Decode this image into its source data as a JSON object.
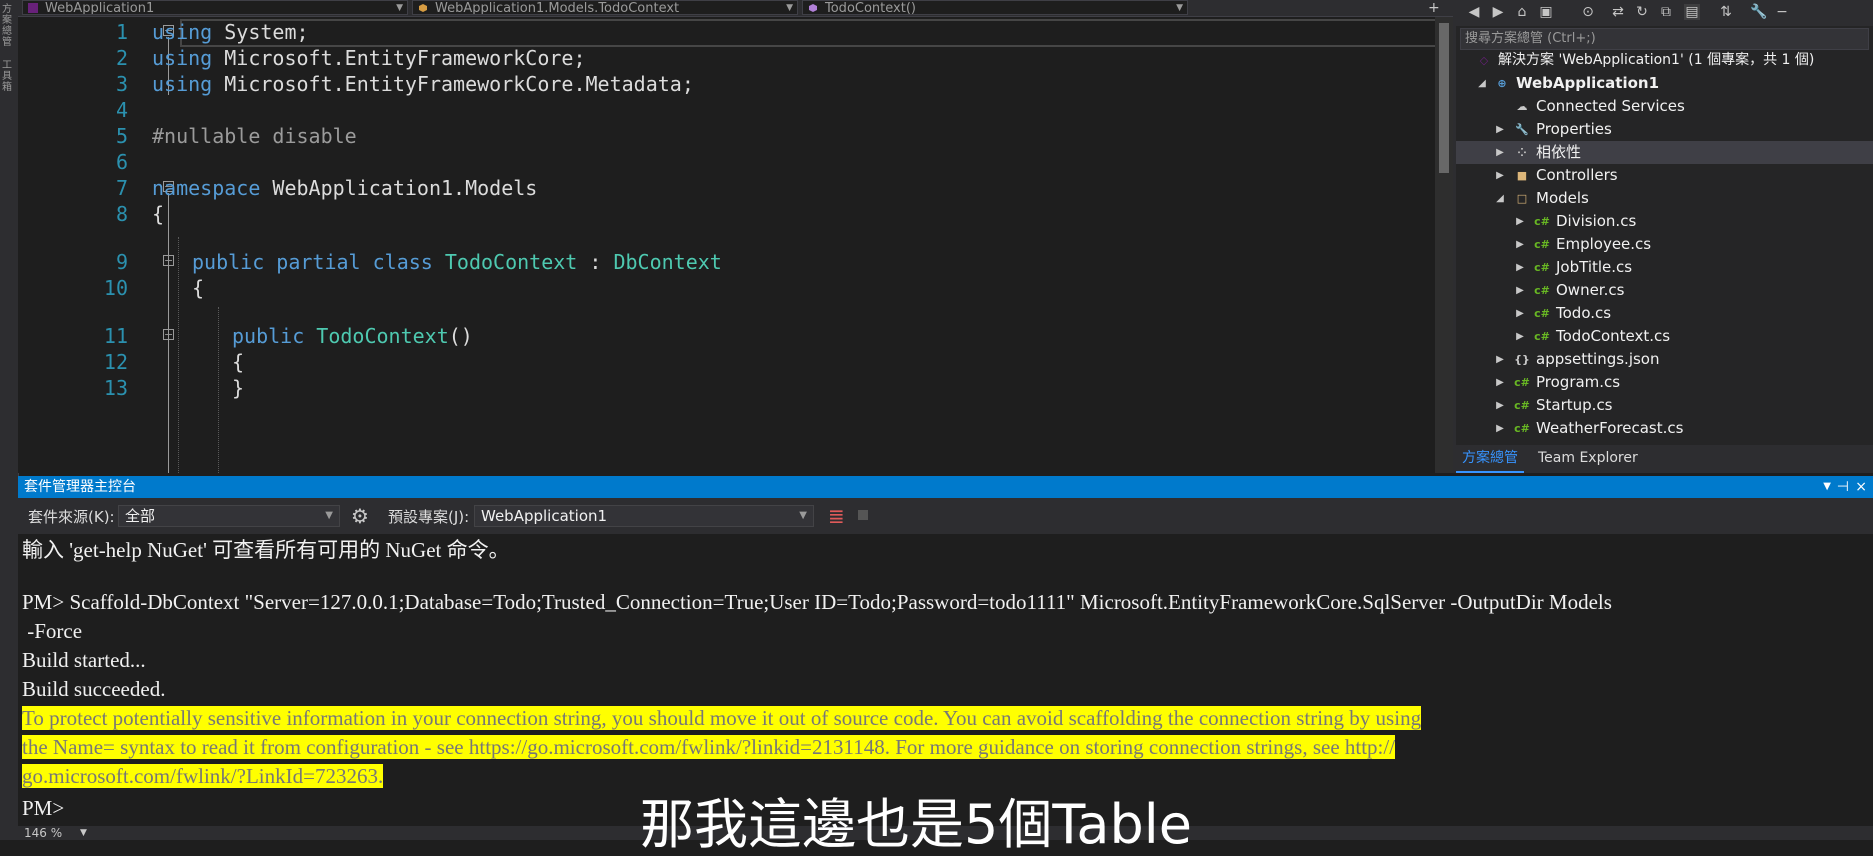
{
  "left_strip": {
    "tab1": "方案總管",
    "tab2": "工具箱"
  },
  "nav": {
    "project": "WebApplication1",
    "class": "WebApplication1.Models.TodoContext",
    "member": "TodoContext()"
  },
  "editor": {
    "line_numbers": [
      "1",
      "2",
      "3",
      "4",
      "5",
      "6",
      "7",
      "8",
      "9",
      "10",
      "11",
      "12",
      "13"
    ],
    "l1_kw": "using",
    "l1_rest": " System;",
    "l2_kw": "using",
    "l2_rest": " Microsoft.EntityFrameworkCore;",
    "l3_kw": "using",
    "l3_rest": " Microsoft.EntityFrameworkCore.Metadata;",
    "l5": "#nullable disable",
    "l7_kw": "namespace",
    "l7_rest": " WebApplication1.Models",
    "l8": "{",
    "l9_kw": "public partial class",
    "l9_name": "TodoContext",
    "l9_sep": " : ",
    "l9_base": "DbContext",
    "l10": "{",
    "l11_kw": "public",
    "l11_name": "TodoContext",
    "l11_rest": "()",
    "l12": "{",
    "l13": "}"
  },
  "solution_explorer": {
    "search_placeholder": "搜尋方案總管 (Ctrl+;)",
    "solution": "解決方案 'WebApplication1' (1 個專案，共 1 個)",
    "project": "WebApplication1",
    "items": [
      {
        "label": "Connected Services"
      },
      {
        "label": "Properties"
      },
      {
        "label": "相依性"
      },
      {
        "label": "Controllers"
      },
      {
        "label": "Models"
      },
      {
        "label": "Division.cs"
      },
      {
        "label": "Employee.cs"
      },
      {
        "label": "JobTitle.cs"
      },
      {
        "label": "Owner.cs"
      },
      {
        "label": "Todo.cs"
      },
      {
        "label": "TodoContext.cs"
      },
      {
        "label": "appsettings.json"
      },
      {
        "label": "Program.cs"
      },
      {
        "label": "Startup.cs"
      },
      {
        "label": "WeatherForecast.cs"
      }
    ],
    "tabs": {
      "solution": "方案總管",
      "team": "Team Explorer"
    }
  },
  "console": {
    "title": "套件管理器主控台",
    "source_label": "套件來源(K):",
    "source_value": "全部",
    "project_label": "預設專案(J):",
    "project_value": "WebApplication1",
    "lines": {
      "help": "輸入 'get-help NuGet' 可查看所有可用的 NuGet 命令。",
      "cmd1": "PM> Scaffold-DbContext \"Server=127.0.0.1;Database=Todo;Trusted_Connection=True;User ID=Todo;Password=todo1111\" Microsoft.EntityFrameworkCore.SqlServer -OutputDir Models",
      "cmd2": " -Force",
      "build1": "Build started...",
      "build2": "Build succeeded.",
      "warn1": "To protect potentially sensitive information in your connection string, you should move it out of source code. You can avoid scaffolding the connection string by using",
      "warn2": "the Name= syntax to read it from configuration - see https://go.microsoft.com/fwlink/?linkid=2131148. For more guidance on storing connection strings, see http://",
      "warn3": "go.microsoft.com/fwlink/?LinkId=723263.",
      "prompt": "PM>"
    },
    "zoom": "146 %"
  },
  "subtitle": "那我這邊也是5個Table",
  "colors": {
    "accent": "#007acc",
    "highlight": "#ffff00",
    "keyword": "#569cd6",
    "type": "#4ec9b0",
    "line_number": "#2b91af"
  }
}
